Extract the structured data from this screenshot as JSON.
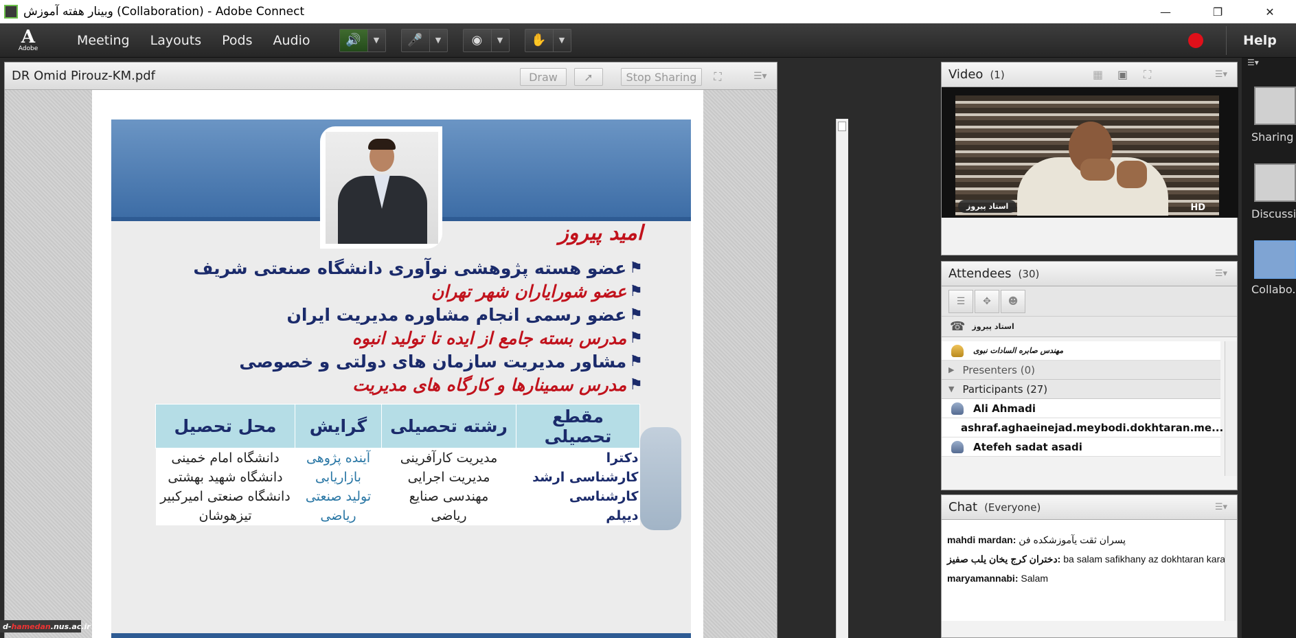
{
  "window": {
    "title": "وبینار هفته آموزش (Collaboration) - Adobe Connect",
    "controls": [
      "minimize",
      "restore",
      "close"
    ]
  },
  "menubar": {
    "logo_letter": "A",
    "logo_text": "Adobe",
    "items": [
      "Meeting",
      "Layouts",
      "Pods",
      "Audio"
    ],
    "help": "Help",
    "record_color": "#e0101a"
  },
  "share": {
    "title": "DR Omid Pirouz-KM.pdf",
    "draw_label": "Draw",
    "stop_label": "Stop Sharing"
  },
  "slide": {
    "name": "امید پیروز",
    "bullets": [
      {
        "text": "عضو هسته پژوهشی نوآوری دانشگاه صنعتی شریف",
        "color": "blue"
      },
      {
        "text": "عضو شورایاران شهر تهران",
        "color": "red"
      },
      {
        "text": "عضو رسمی انجام مشاوره مدیریت ایران",
        "color": "blue"
      },
      {
        "text": "مدرس بسته جامع از ایده تا تولید انبوه",
        "color": "red"
      },
      {
        "text": "مشاور مدیریت سازمان های دولتی و خصوصی",
        "color": "blue"
      },
      {
        "text": "مدرس سمینارها و کارگاه های مدیریت",
        "color": "red"
      }
    ],
    "table": {
      "headers": [
        "مقطع تحصیلی",
        "رشته تحصیلی",
        "گرایش",
        "محل تحصیل"
      ],
      "rows": [
        [
          "دکترا",
          "مدیریت کارآفرینی",
          "آینده پژوهی",
          "دانشگاه امام خمینی"
        ],
        [
          "کارشناسی ارشد",
          "مدیریت اجرایی",
          "بازاریابی",
          "دانشگاه شهید بهشتی"
        ],
        [
          "کارشناسی",
          "مهندسی صنایع",
          "تولید صنعتی",
          "دانشگاه صنعتی امیرکبیر"
        ],
        [
          "دیپلم",
          "ریاضی",
          "ریاضی",
          "تیزهوشان"
        ]
      ]
    }
  },
  "watermark": {
    "prefix": "d-",
    "highlight": "hamedan",
    "suffix": ".nus.ac.ir"
  },
  "video": {
    "title": "Video",
    "count": "(1)",
    "label": "استاد پیروز",
    "quality": "HD"
  },
  "attendees": {
    "title": "Attendees",
    "count": "(30)",
    "host": "استاد پیروز",
    "first": "مهندس صابره السادات نبوی",
    "presenters": "Presenters (0)",
    "participants": "Participants (27)",
    "list": [
      "Ali Ahmadi",
      "ashraf.aghaeinejad.meybodi.dokhtaran.me...",
      "Atefeh sadat asadi"
    ]
  },
  "chat": {
    "title": "Chat",
    "scope": "(Everyone)",
    "messages": [
      {
        "name": "mahdi mardan:",
        "text": " پسران ثقت یآموزشکده فن"
      },
      {
        "name": "دختران کرج یخان یلب صفیز:",
        "text": " ba salam safikhany  az dokhtaran  karaj"
      },
      {
        "name": "maryamannabi:",
        "text": " Salam"
      }
    ]
  },
  "layouts": {
    "items": [
      "Sharing",
      "Discussio",
      "Collabo..."
    ],
    "selected": "Collabo..."
  }
}
